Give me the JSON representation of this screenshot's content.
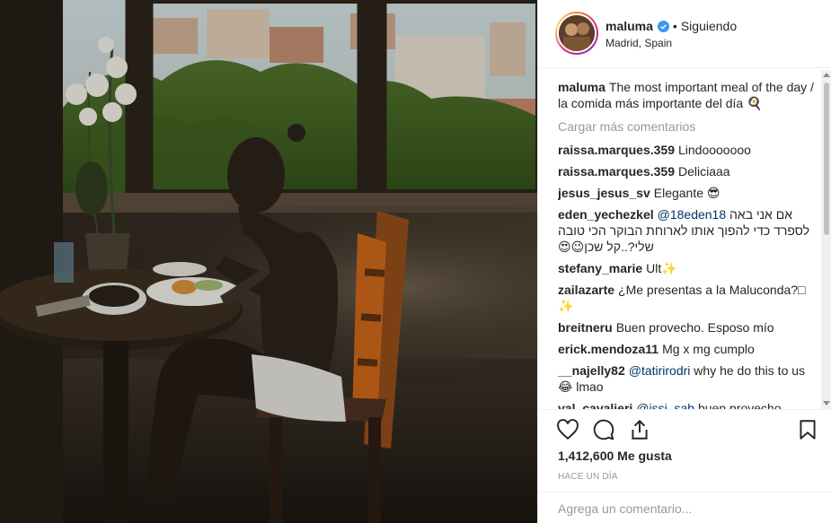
{
  "header": {
    "username": "maluma",
    "separator": "•",
    "follow_state": "Siguiendo",
    "location": "Madrid, Spain"
  },
  "caption": {
    "username": "maluma",
    "text": "The most important meal of the day / la comida más importante del día 🍳"
  },
  "load_more_label": "Cargar más comentarios",
  "comments": [
    {
      "username": "raissa.marques.359",
      "mention": "",
      "text": "Lindooooooo"
    },
    {
      "username": "raissa.marques.359",
      "mention": "",
      "text": "Deliciaaa"
    },
    {
      "username": "jesus_jesus_sv",
      "mention": "",
      "text": "Elegante 😎"
    },
    {
      "username": "eden_yechezkel",
      "mention": "@18eden18",
      "text": "אם אני באה לספרד כדי להפוך אותו לארוחת הבוקר הכי טובה שלי?..קל שכן😉😍"
    },
    {
      "username": "stefany_marie",
      "mention": "",
      "text": "Ult✨"
    },
    {
      "username": "zailazarte",
      "mention": "",
      "text": "¿Me presentas a la Maluconda?□ ✨"
    },
    {
      "username": "breitneru",
      "mention": "",
      "text": "Buen provecho. Esposo mío"
    },
    {
      "username": "erick.mendoza11",
      "mention": "",
      "text": "Mg x mg cumplo"
    },
    {
      "username": "__najelly82",
      "mention": "@tatirirodri",
      "text": "why he do this to us 😂 lmao"
    },
    {
      "username": "val_cavalieri",
      "mention": "@issi_sab",
      "text": "buen provecho ..."
    }
  ],
  "actions": {
    "like_icon": "heart-icon",
    "comment_icon": "comment-icon",
    "share_icon": "share-icon",
    "save_icon": "bookmark-icon"
  },
  "likes_text": "1,412,600 Me gusta",
  "timestamp": "HACE UN DÍA",
  "comment_input": {
    "placeholder": "Agrega un comentario...",
    "value": ""
  },
  "colors": {
    "verified": "#3897f0",
    "text": "#262626",
    "muted": "#999999",
    "link": "#003569"
  }
}
